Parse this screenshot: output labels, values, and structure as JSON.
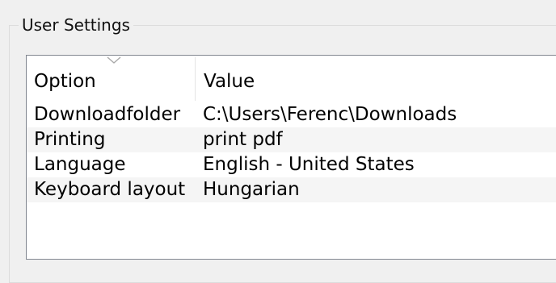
{
  "group": {
    "title": "User Settings"
  },
  "table": {
    "columns": [
      "Option",
      "Value"
    ],
    "rows": [
      {
        "option": "Downloadfolder",
        "value": "C:\\Users\\Ferenc\\Downloads"
      },
      {
        "option": "Printing",
        "value": "print pdf"
      },
      {
        "option": "Language",
        "value": "English - United States"
      },
      {
        "option": "Keyboard layout",
        "value": "Hungarian"
      }
    ],
    "sort_indicator_icon": "chevron-down-icon"
  },
  "colors": {
    "window_background": "#f0f0f0",
    "list_background": "#ffffff",
    "alt_row_background": "#f5f5f5",
    "list_border": "#828790"
  }
}
